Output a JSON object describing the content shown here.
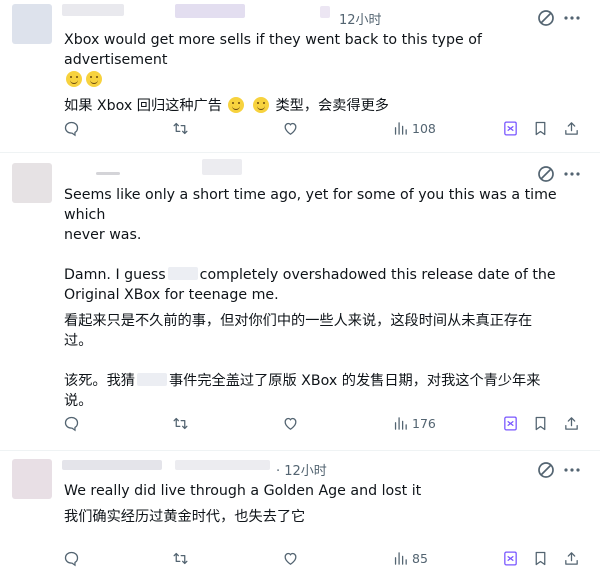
{
  "replies": [
    {
      "time": "12小时",
      "lines": [
        "Xbox would get more sells if they went back to this type of advertisement",
        "如果 Xbox 回归这种广告",
        "类型，会卖得更多"
      ],
      "stats": {
        "views": "108"
      }
    },
    {
      "lines": [
        "Seems like only a short time ago, yet for some of you this was a time which",
        "never was.",
        "Damn. I guess",
        "completely overshadowed this release date of the",
        "Original XBox for teenage me.",
        "看起来只是不久前的事，但对你们中的一些人来说，这段时间从未真正存在",
        "过。",
        "该死。我猜",
        "事件完全盖过了原版 XBox 的发售日期，对我这个青少年来",
        "说。"
      ],
      "stats": {
        "views": "176"
      }
    },
    {
      "time": "· 12小时",
      "lines": [
        "We really did live through a Golden Age and lost it",
        "我们确实经历过黄金时代，也失去了它"
      ],
      "stats": {
        "views": "85"
      }
    }
  ],
  "icons": [
    "reply-icon",
    "retweet-icon",
    "like-icon",
    "views-icon",
    "grok-icon",
    "bookmark-icon",
    "share-icon",
    "grok-header-icon",
    "more-icon"
  ],
  "colors": {
    "text": "#0f1419",
    "secondary": "#536471",
    "divider": "#eff3f4",
    "grok": "#7856ff"
  }
}
